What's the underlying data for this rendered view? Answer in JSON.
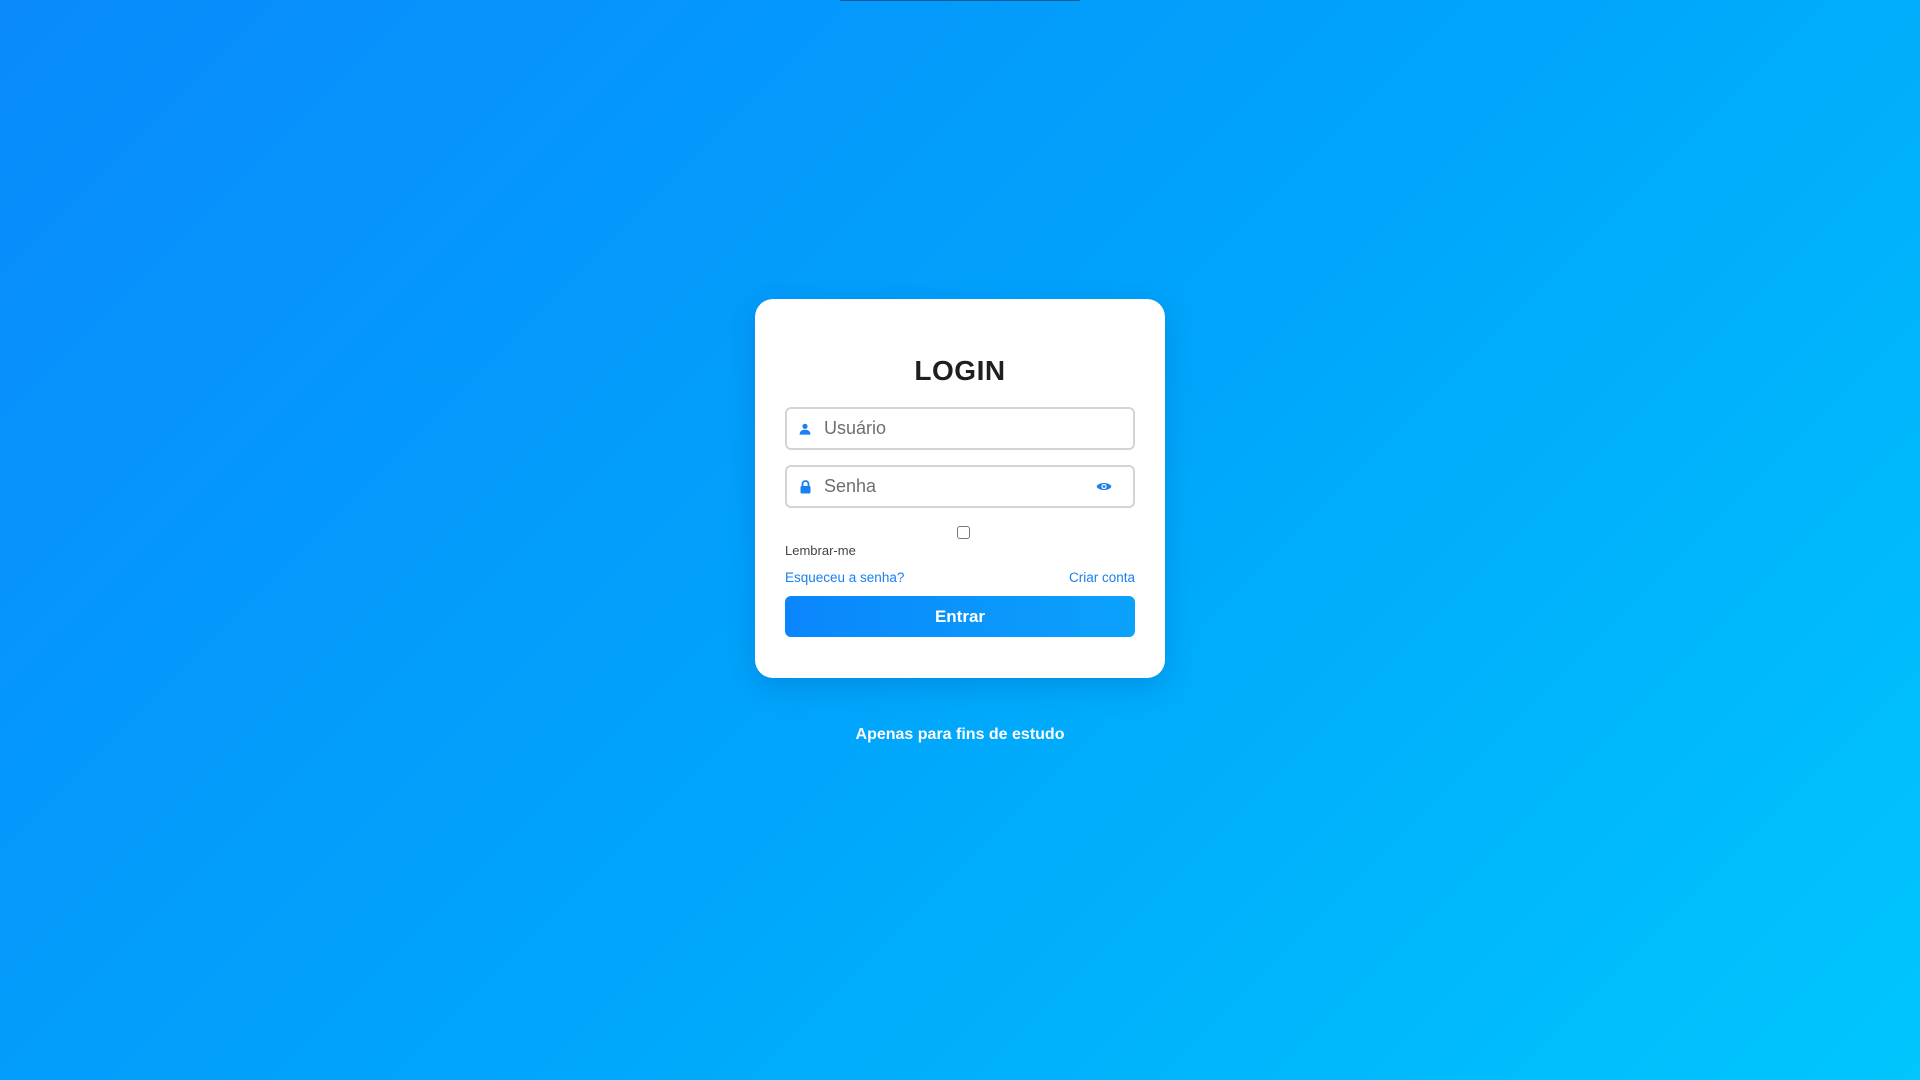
{
  "login": {
    "title": "LOGIN",
    "username_placeholder": "Usuário",
    "password_placeholder": "Senha",
    "remember_label": "Lembrar-me",
    "forgot_link": "Esqueceu a senha?",
    "create_link": "Criar conta",
    "submit_label": "Entrar"
  },
  "footer": {
    "note": "Apenas para fins de estudo"
  },
  "colors": {
    "accent": "#1a7ff0",
    "background_start": "#0a8afc",
    "background_end": "#00c6fd"
  },
  "icons": {
    "username": "user-icon",
    "password": "lock-icon",
    "toggle_password": "eye-icon"
  }
}
